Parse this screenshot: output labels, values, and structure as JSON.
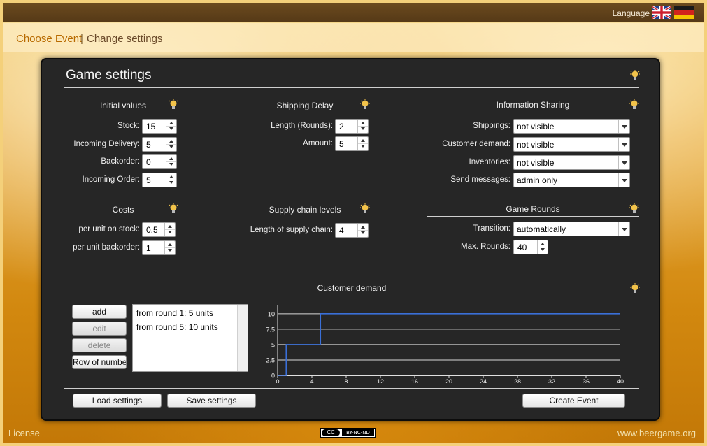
{
  "header": {
    "language_label": "Language",
    "flags": [
      "uk-flag-icon",
      "germany-flag-icon"
    ]
  },
  "nav": {
    "choose_event": "Choose Event",
    "separator": "|",
    "change_settings": "Change settings"
  },
  "panel": {
    "title": "Game settings"
  },
  "initial_values": {
    "title": "Initial values",
    "stock_label": "Stock:",
    "stock": "15",
    "incoming_delivery_label": "Incoming Delivery:",
    "incoming_delivery": "5",
    "backorder_label": "Backorder:",
    "backorder": "0",
    "incoming_order_label": "Incoming Order:",
    "incoming_order": "5"
  },
  "shipping_delay": {
    "title": "Shipping Delay",
    "length_label": "Length (Rounds):",
    "length": "2",
    "amount_label": "Amount:",
    "amount": "5"
  },
  "information_sharing": {
    "title": "Information Sharing",
    "shippings_label": "Shippings:",
    "shippings": "not visible",
    "customer_demand_label": "Customer demand:",
    "customer_demand": "not visible",
    "inventories_label": "Inventories:",
    "inventories": "not visible",
    "send_messages_label": "Send messages:",
    "send_messages": "admin only"
  },
  "costs": {
    "title": "Costs",
    "stock_label": "per unit on stock:",
    "stock": "0.5",
    "backorder_label": "per unit backorder:",
    "backorder": "1"
  },
  "supply_chain": {
    "title": "Supply chain levels",
    "length_label": "Length of supply chain:",
    "length": "4"
  },
  "game_rounds": {
    "title": "Game Rounds",
    "transition_label": "Transition:",
    "transition": "automatically",
    "max_rounds_label": "Max. Rounds:",
    "max_rounds": "40"
  },
  "customer_demand": {
    "title": "Customer demand",
    "buttons": {
      "add": "add",
      "edit": "edit",
      "delete": "delete",
      "row_of_numbers": "Row of numbe"
    },
    "entries": [
      "from round 1: 5 units",
      "from round 5: 10 units"
    ]
  },
  "chart_data": {
    "type": "line",
    "title": "",
    "xlabel": "",
    "ylabel": "",
    "xlim": [
      0,
      40
    ],
    "ylim": [
      0,
      11
    ],
    "x_ticks": [
      0,
      4,
      8,
      12,
      16,
      20,
      24,
      28,
      32,
      36,
      40
    ],
    "y_ticks": [
      0,
      2.5,
      5,
      7.5,
      10
    ],
    "y_tick_labels": [
      "0",
      "2.5",
      "5",
      "7.5",
      "10"
    ],
    "grid": true,
    "series": [
      {
        "x": [
          0,
          1,
          1,
          5,
          5,
          40
        ],
        "y": [
          0,
          0,
          5,
          5,
          10,
          10
        ],
        "color": "#3a6fd8"
      }
    ]
  },
  "footer_buttons": {
    "load": "Load settings",
    "save": "Save settings",
    "create": "Create Event"
  },
  "footer": {
    "license": "License",
    "cc_badge": "BY-NC-ND",
    "cc": "CC",
    "site": "www.beergame.org"
  }
}
